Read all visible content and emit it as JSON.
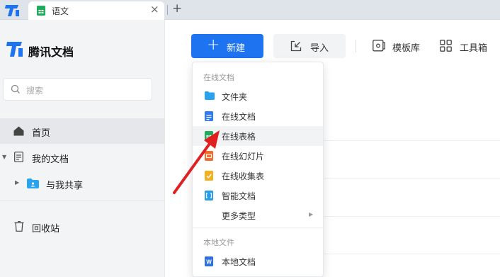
{
  "tabbar": {
    "tab_title": "语文",
    "close_glyph": "×",
    "add_glyph": "+"
  },
  "sidebar": {
    "brand": "腾讯文档",
    "search_placeholder": "搜索",
    "items": [
      {
        "label": "首页",
        "icon": "home-icon"
      },
      {
        "label": "我的文档",
        "icon": "document-icon"
      },
      {
        "label": "与我共享",
        "icon": "shared-folder-icon"
      },
      {
        "label": "回收站",
        "icon": "trash-icon"
      }
    ]
  },
  "toolbar": {
    "new_label": "新建",
    "import_label": "导入",
    "templates_label": "模板库",
    "tools_label": "工具箱"
  },
  "menu": {
    "online_group": "在线文档",
    "online_items": [
      {
        "label": "文件夹",
        "icon": "folder-icon"
      },
      {
        "label": "在线文档",
        "icon": "doc-icon"
      },
      {
        "label": "在线表格",
        "icon": "sheet-icon"
      },
      {
        "label": "在线幻灯片",
        "icon": "slide-icon"
      },
      {
        "label": "在线收集表",
        "icon": "form-icon"
      },
      {
        "label": "智能文档",
        "icon": "smart-doc-icon"
      },
      {
        "label": "更多类型",
        "icon": "more-arrow-icon"
      }
    ],
    "local_group": "本地文件",
    "local_items": [
      {
        "label": "本地文档",
        "icon": "word-icon"
      }
    ]
  },
  "colors": {
    "accent": "#1d73f0",
    "annotation_arrow": "#e02020",
    "sheet_green": "#1fad5c"
  }
}
